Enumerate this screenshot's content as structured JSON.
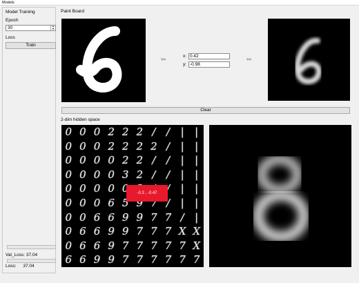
{
  "window": {
    "title": "Models"
  },
  "sidebar": {
    "section_title": "Model Training",
    "epoch_label": "Epoch",
    "epoch_value": "30",
    "loss_label": "Loss",
    "train_label": "Train",
    "val_loss_label": "Val_Loss:",
    "val_loss_value": "37.04",
    "loss_label2": "Loss:",
    "loss_value": "37.04"
  },
  "main": {
    "paint_board_label": "Paint Board",
    "input_digit": "6",
    "output_digit": "6",
    "x_label": "x:",
    "x_value": "0.42",
    "y_label": "y:",
    "y_value": "-0.98",
    "arrow_in": ">>",
    "arrow_out": ">>",
    "clear_label": "Clear",
    "hidden_space_label": "2-dim hidden space",
    "tooltip": "-0.3 , -0.47",
    "decoded_digit": "8"
  },
  "latent_grid": [
    [
      "0",
      "0",
      "0",
      "2",
      "2",
      "2",
      "/",
      "/",
      "|",
      "|"
    ],
    [
      "0",
      "0",
      "0",
      "2",
      "2",
      "2",
      "2",
      "/",
      "|",
      "|"
    ],
    [
      "0",
      "0",
      "0",
      "0",
      "2",
      "2",
      "/",
      "/",
      "|",
      "|"
    ],
    [
      "0",
      "0",
      "0",
      "0",
      "3",
      "2",
      "/",
      "/",
      "|",
      "|"
    ],
    [
      "0",
      "0",
      "0",
      "0",
      "0",
      "3",
      "/",
      "/",
      "|",
      "|"
    ],
    [
      "0",
      "0",
      "0",
      "6",
      "5",
      "9",
      "7",
      "/",
      "|",
      "|"
    ],
    [
      "0",
      "0",
      "6",
      "6",
      "9",
      "9",
      "7",
      "7",
      "/",
      "|"
    ],
    [
      "0",
      "6",
      "6",
      "9",
      "9",
      "7",
      "7",
      "7",
      "X",
      "X"
    ],
    [
      "0",
      "6",
      "6",
      "9",
      "7",
      "7",
      "7",
      "7",
      "7",
      "X"
    ],
    [
      "6",
      "6",
      "9",
      "9",
      "7",
      "7",
      "7",
      "7",
      "7",
      "7"
    ]
  ]
}
